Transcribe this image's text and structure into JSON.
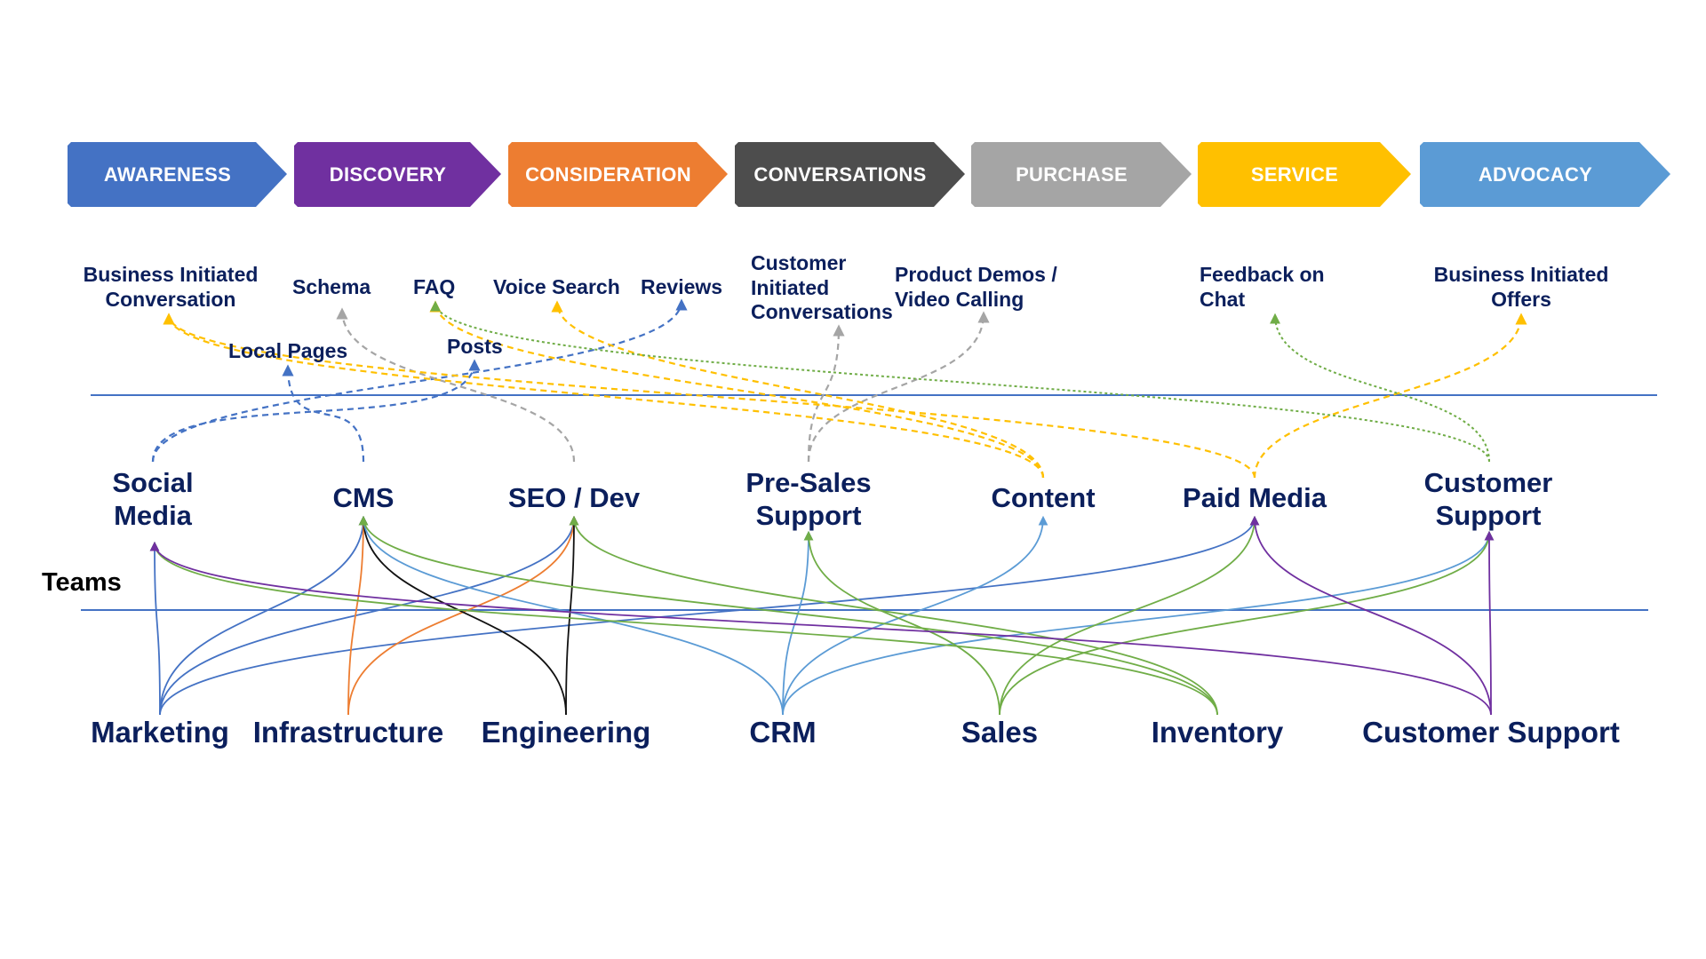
{
  "colors": {
    "text": "#0b1f5c",
    "rule": "#4472c4",
    "blue": "#4472c4",
    "lightblue": "#5b9bd5",
    "orange": "#ed7d31",
    "black": "#111111",
    "green": "#70ad47",
    "purple": "#7030a0",
    "yellow": "#ffc000",
    "gray": "#a5a5a5"
  },
  "stages": [
    {
      "label": "AWARENESS",
      "color": "#4472c4"
    },
    {
      "label": "DISCOVERY",
      "color": "#7030a0"
    },
    {
      "label": "CONSIDERATION",
      "color": "#ed7d31"
    },
    {
      "label": "CONVERSATIONS",
      "color": "#4d4d4d"
    },
    {
      "label": "PURCHASE",
      "color": "#a5a5a5"
    },
    {
      "label": "SERVICE",
      "color": "#ffc000"
    },
    {
      "label": "ADVOCACY",
      "color": "#5b9bd5"
    }
  ],
  "touchpoints": {
    "business_initiated_conversation": "Business Initiated\nConversation",
    "schema": "Schema",
    "faq": "FAQ",
    "voice_search": "Voice Search",
    "reviews": "Reviews",
    "local_pages": "Local Pages",
    "posts": "Posts",
    "customer_initiated_conversations": "Customer\nInitiated\nConversations",
    "product_demos": "Product Demos /\nVideo Calling",
    "feedback_on_chat": "Feedback on\nChat",
    "business_initiated_offers": "Business Initiated\nOffers"
  },
  "departments": {
    "social_media": "Social\nMedia",
    "cms": "CMS",
    "seo_dev": "SEO / Dev",
    "pre_sales_support": "Pre-Sales\nSupport",
    "content": "Content",
    "paid_media": "Paid Media",
    "customer_support": "Customer\nSupport"
  },
  "teams_heading": "Teams",
  "teams": {
    "marketing": "Marketing",
    "infrastructure": "Infrastructure",
    "engineering": "Engineering",
    "crm": "CRM",
    "sales": "Sales",
    "inventory": "Inventory",
    "customer_support": "Customer Support"
  },
  "dashed_links": [
    {
      "from": "social_media",
      "to": "reviews",
      "color": "blue"
    },
    {
      "from": "social_media",
      "to": "posts",
      "color": "blue"
    },
    {
      "from": "cms",
      "to": "local_pages",
      "color": "blue"
    },
    {
      "from": "seo_dev",
      "to": "schema",
      "color": "gray"
    },
    {
      "from": "pre_sales_support",
      "to": "customer_initiated_conversations",
      "color": "gray"
    },
    {
      "from": "pre_sales_support",
      "to": "product_demos",
      "color": "gray"
    },
    {
      "from": "content",
      "to": "business_initiated_conversation",
      "color": "yellow"
    },
    {
      "from": "content",
      "to": "faq",
      "color": "yellow"
    },
    {
      "from": "content",
      "to": "voice_search",
      "color": "yellow"
    },
    {
      "from": "paid_media",
      "to": "business_initiated_conversation",
      "color": "yellow"
    },
    {
      "from": "paid_media",
      "to": "business_initiated_offers",
      "color": "yellow"
    },
    {
      "from": "customer_support",
      "to": "faq",
      "color": "green"
    },
    {
      "from": "customer_support",
      "to": "feedback_on_chat",
      "color": "green"
    }
  ],
  "team_links": [
    {
      "from": "marketing",
      "to": "social_media",
      "color": "blue"
    },
    {
      "from": "marketing",
      "to": "cms",
      "color": "blue"
    },
    {
      "from": "marketing",
      "to": "seo_dev",
      "color": "blue"
    },
    {
      "from": "marketing",
      "to": "paid_media",
      "color": "blue"
    },
    {
      "from": "infrastructure",
      "to": "cms",
      "color": "orange"
    },
    {
      "from": "infrastructure",
      "to": "seo_dev",
      "color": "orange"
    },
    {
      "from": "engineering",
      "to": "cms",
      "color": "black"
    },
    {
      "from": "engineering",
      "to": "seo_dev",
      "color": "black"
    },
    {
      "from": "crm",
      "to": "cms",
      "color": "lightblue"
    },
    {
      "from": "crm",
      "to": "pre_sales_support",
      "color": "lightblue"
    },
    {
      "from": "crm",
      "to": "content",
      "color": "lightblue"
    },
    {
      "from": "crm",
      "to": "customer_support",
      "color": "lightblue"
    },
    {
      "from": "sales",
      "to": "pre_sales_support",
      "color": "green"
    },
    {
      "from": "sales",
      "to": "paid_media",
      "color": "green"
    },
    {
      "from": "sales",
      "to": "customer_support",
      "color": "green"
    },
    {
      "from": "inventory",
      "to": "social_media",
      "color": "green"
    },
    {
      "from": "inventory",
      "to": "cms",
      "color": "green"
    },
    {
      "from": "inventory",
      "to": "seo_dev",
      "color": "green"
    },
    {
      "from": "customer_support",
      "to": "social_media",
      "color": "purple"
    },
    {
      "from": "customer_support",
      "to": "paid_media",
      "color": "purple"
    },
    {
      "from": "customer_support",
      "to": "customer_support",
      "color": "purple"
    }
  ]
}
